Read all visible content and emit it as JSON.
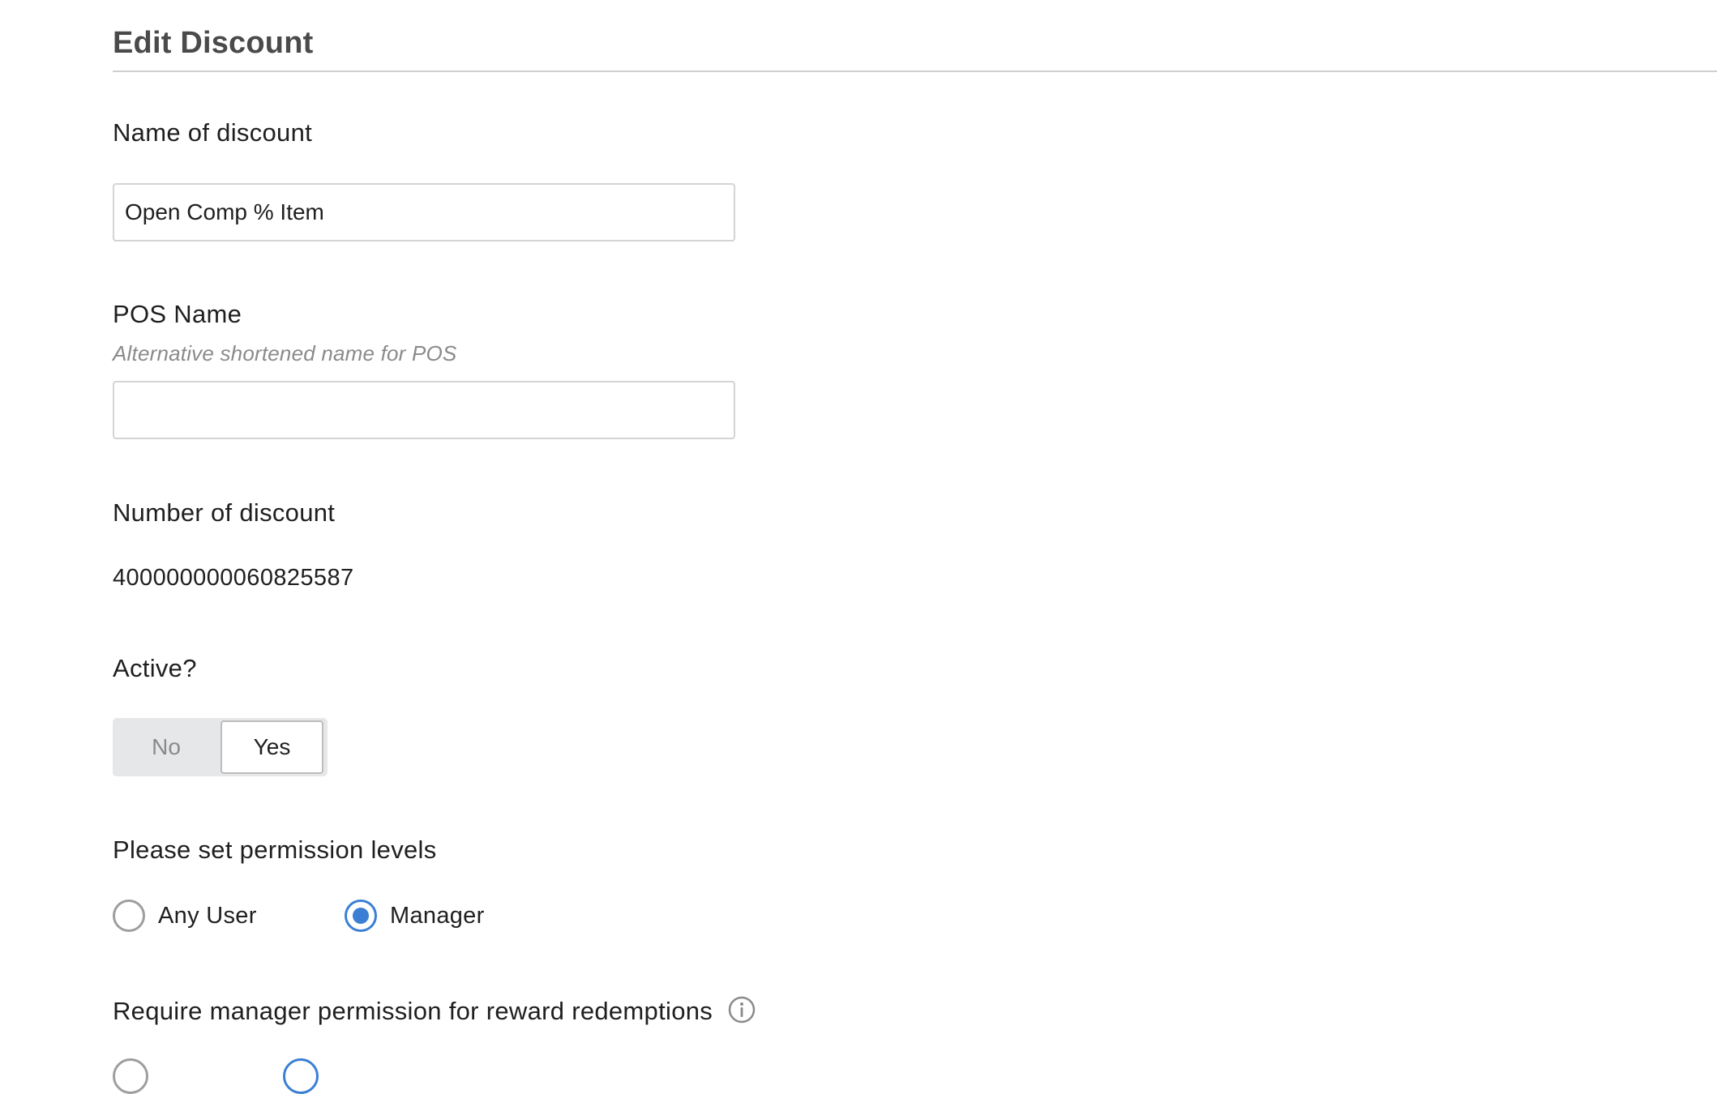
{
  "header": {
    "title": "Edit Discount"
  },
  "form": {
    "name_of_discount": {
      "label": "Name of discount",
      "value": "Open Comp % Item"
    },
    "pos_name": {
      "label": "POS Name",
      "hint": "Alternative shortened name for POS",
      "value": ""
    },
    "number_of_discount": {
      "label": "Number of discount",
      "value": "400000000060825587"
    },
    "active": {
      "label": "Active?",
      "options": [
        "No",
        "Yes"
      ],
      "selected": "Yes"
    },
    "permission_levels": {
      "label": "Please set permission levels",
      "options": [
        "Any User",
        "Manager"
      ],
      "selected": "Manager"
    },
    "reward_redemptions": {
      "label": "Require manager permission for reward redemptions",
      "icon": "info-icon"
    }
  },
  "colors": {
    "accent": "#3b7fd4",
    "title": "#4a4a4a",
    "hint": "#8a8a8a",
    "toggle_bg": "#e6e7e9"
  }
}
